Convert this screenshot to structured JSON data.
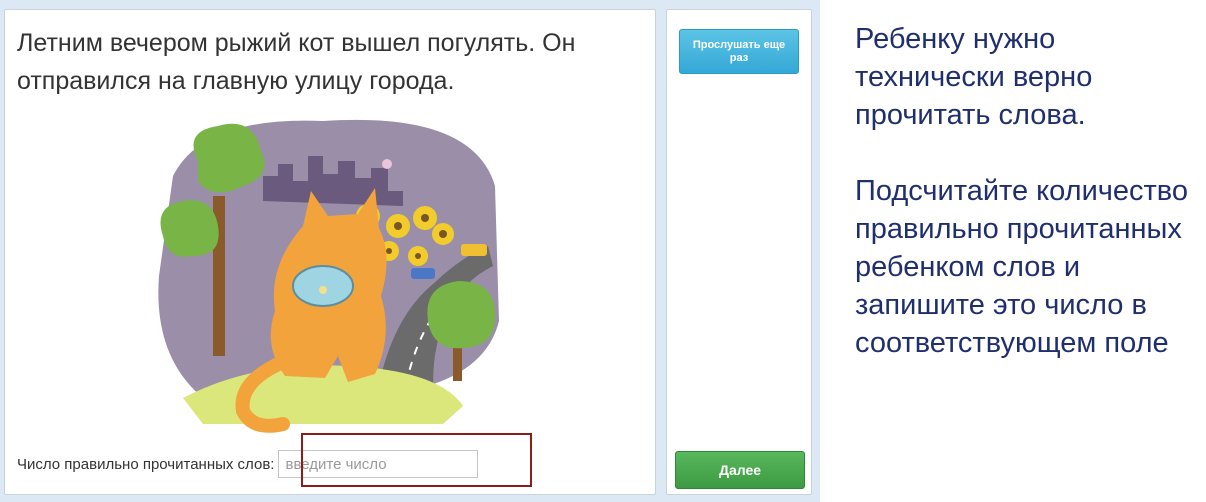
{
  "story": {
    "text": "Летним вечером рыжий кот вышел погулять. Он отправился на главную улицу города."
  },
  "answer": {
    "label": "Число правильно прочитанных слов:",
    "placeholder": "введите число",
    "value": ""
  },
  "sidebar": {
    "replay_label": "Прослушать еще раз",
    "next_label": "Далее"
  },
  "instructions": {
    "paragraph1": "Ребенку нужно технически верно прочитать слова.",
    "paragraph2": "Подсчитайте количество правильно прочитанных ребенком слов и запишите это число в соответствующем поле"
  },
  "colors": {
    "instruction_text": "#1f2f6e",
    "replay_button": "#3fb3dd",
    "next_button": "#4aa94e",
    "highlight_frame": "#8b1c1c",
    "background": "#dce9f4"
  },
  "illustration": {
    "icon": "orange-cat-city-street-illustration"
  }
}
